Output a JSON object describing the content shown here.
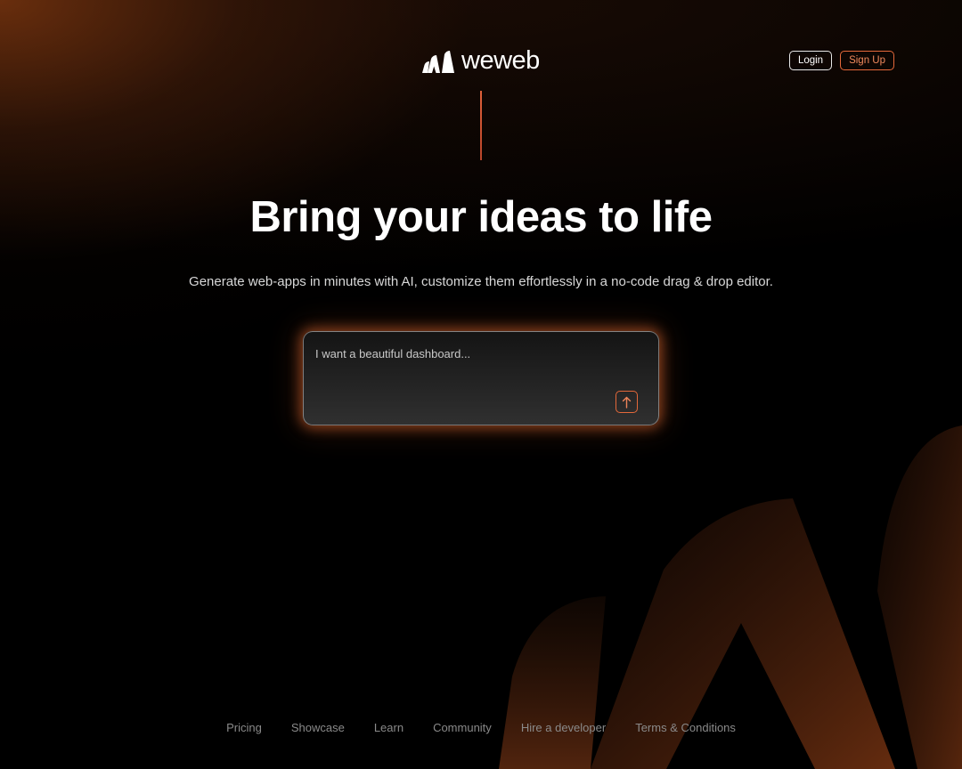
{
  "brand": {
    "name": "weweb",
    "accent": "#e4683a"
  },
  "header": {
    "login_label": "Login",
    "signup_label": "Sign Up"
  },
  "hero": {
    "title": "Bring your ideas to life",
    "subtitle": "Generate web-apps in minutes with AI, customize them effortlessly in a no-code drag & drop editor."
  },
  "prompt": {
    "placeholder": "I want a beautiful dashboard...",
    "send_icon": "arrow-up-icon"
  },
  "footer": {
    "links": [
      "Pricing",
      "Showcase",
      "Learn",
      "Community",
      "Hire a developer",
      "Terms & Conditions"
    ]
  }
}
